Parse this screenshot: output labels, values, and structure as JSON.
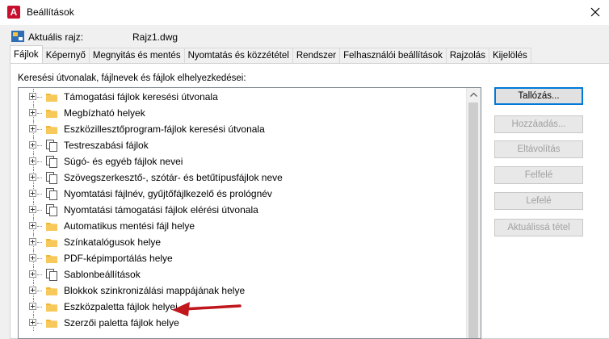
{
  "window": {
    "title": "Beállítások",
    "app_icon_letter": "A"
  },
  "drawing": {
    "label": "Aktuális rajz:",
    "name": "Rajz1.dwg"
  },
  "tabs": [
    {
      "label": "Fájlok"
    },
    {
      "label": "Képernyő"
    },
    {
      "label": "Megnyitás és mentés"
    },
    {
      "label": "Nyomtatás és közzététel"
    },
    {
      "label": "Rendszer"
    },
    {
      "label": "Felhasználói beállítások"
    },
    {
      "label": "Rajzolás"
    },
    {
      "label": "Kijelölés"
    }
  ],
  "section_label": "Keresési útvonalak, fájlnevek és fájlok elhelyezkedései:",
  "tree_items": [
    {
      "label": "Támogatási fájlok keresési útvonala",
      "icon": "folder-icon"
    },
    {
      "label": "Megbízható helyek",
      "icon": "folder-icon"
    },
    {
      "label": "Eszközillesztőprogram-fájlok keresési útvonala",
      "icon": "folder-icon"
    },
    {
      "label": "Testreszabási fájlok",
      "icon": "files-icon"
    },
    {
      "label": "Súgó- és egyéb fájlok nevei",
      "icon": "files-icon"
    },
    {
      "label": "Szövegszerkesztő-, szótár- és betűtípusfájlok neve",
      "icon": "files-icon"
    },
    {
      "label": "Nyomtatási fájlnév, gyűjtőfájlkezelő és prológnév",
      "icon": "files-icon"
    },
    {
      "label": "Nyomtatási támogatási fájlok elérési útvonala",
      "icon": "files-icon"
    },
    {
      "label": "Automatikus mentési fájl helye",
      "icon": "folder-icon"
    },
    {
      "label": "Színkatalógusok helye",
      "icon": "folder-icon"
    },
    {
      "label": "PDF-képimportálás helye",
      "icon": "folder-icon"
    },
    {
      "label": "Sablonbeállítások",
      "icon": "files-icon"
    },
    {
      "label": "Blokkok szinkronizálási mappájának helye",
      "icon": "folder-icon"
    },
    {
      "label": "Eszközpaletta fájlok helyei",
      "icon": "folder-icon"
    },
    {
      "label": "Szerzői paletta fájlok helye",
      "icon": "folder-icon"
    }
  ],
  "buttons": {
    "browse": "Tallózás...",
    "add": "Hozzáadás...",
    "remove": "Eltávolítás",
    "move_up": "Felfelé",
    "move_down": "Lefelé",
    "set_current": "Aktuálissá tétel"
  },
  "colors": {
    "annotation_arrow": "#c0171d",
    "folder": "#f2b632",
    "accent": "#0078d7"
  }
}
